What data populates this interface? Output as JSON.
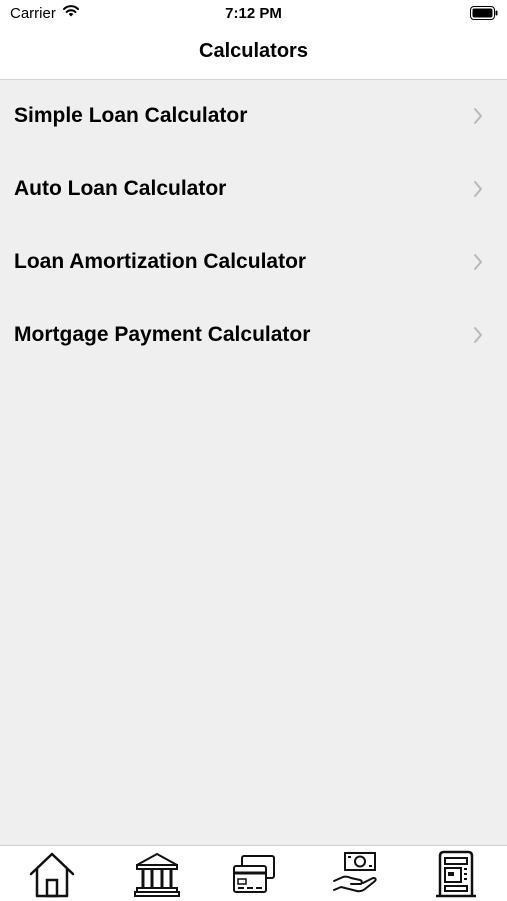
{
  "status_bar": {
    "carrier": "Carrier",
    "time": "7:12 PM"
  },
  "nav": {
    "title": "Calculators"
  },
  "items": [
    {
      "label": "Simple Loan Calculator"
    },
    {
      "label": "Auto Loan Calculator"
    },
    {
      "label": "Loan Amortization Calculator"
    },
    {
      "label": "Mortgage Payment Calculator"
    }
  ],
  "tabs": [
    {
      "icon": "home-icon"
    },
    {
      "icon": "bank-icon"
    },
    {
      "icon": "credit-card-icon"
    },
    {
      "icon": "money-hand-icon"
    },
    {
      "icon": "atm-icon"
    }
  ],
  "colors": {
    "background": "#efefef",
    "chevron": "#b8b8bc",
    "bar": "#ffffff"
  }
}
